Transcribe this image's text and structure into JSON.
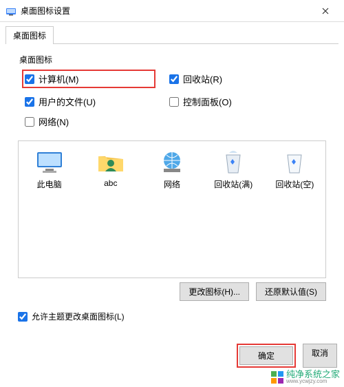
{
  "window": {
    "title": "桌面图标设置"
  },
  "tabs": {
    "desktop_icons": "桌面图标"
  },
  "section": {
    "label": "桌面图标"
  },
  "checks": {
    "computer": {
      "label": "计算机(M)",
      "checked": true
    },
    "recycle": {
      "label": "回收站(R)",
      "checked": true
    },
    "userfiles": {
      "label": "用户的文件(U)",
      "checked": true
    },
    "ctrlpanel": {
      "label": "控制面板(O)",
      "checked": false
    },
    "network": {
      "label": "网络(N)",
      "checked": false
    }
  },
  "icons": {
    "thispc": "此电脑",
    "user": "abc",
    "net": "网络",
    "binfull": "回收站(满)",
    "binempty": "回收站(空)"
  },
  "buttons": {
    "change": "更改图标(H)...",
    "restore": "还原默认值(S)",
    "ok": "确定",
    "cancel": "取消"
  },
  "allow_theme": {
    "label": "允许主题更改桌面图标(L)",
    "checked": true
  },
  "watermark": "纯净系统之家",
  "watermark_sub": "www.ycwjzy.com"
}
